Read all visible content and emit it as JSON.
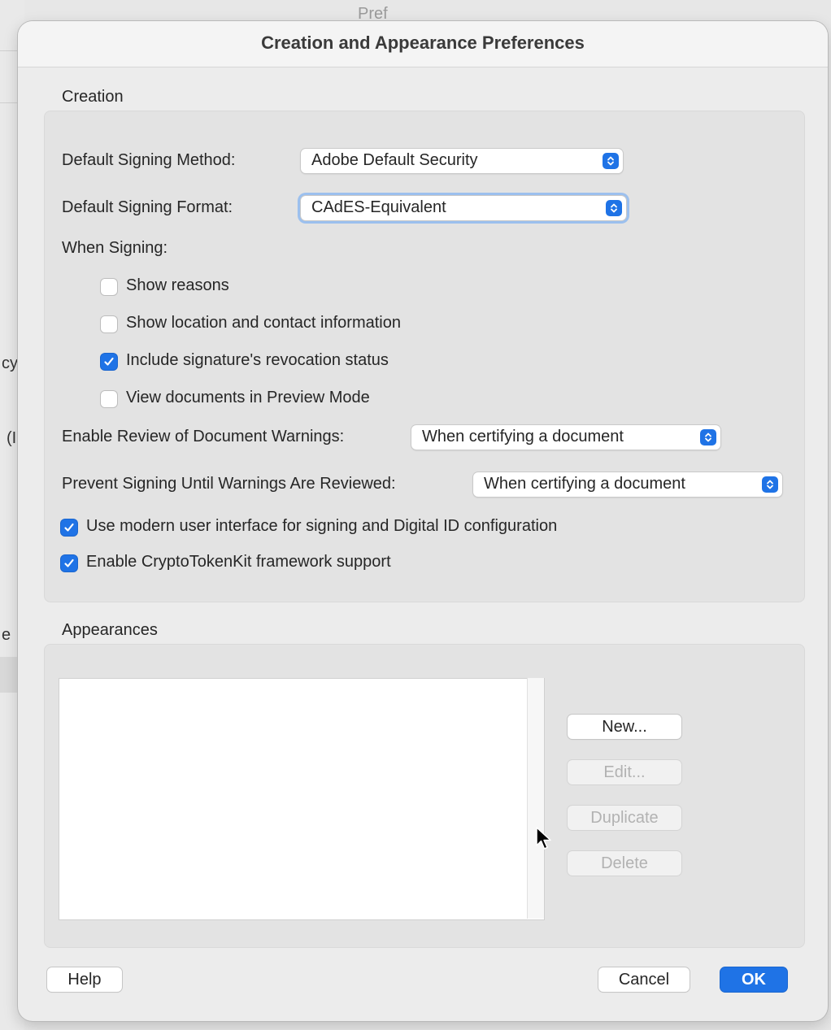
{
  "background": {
    "window_title_fragment": "Pref",
    "fragments": [
      "cy",
      "(I",
      "e"
    ]
  },
  "dialog": {
    "title": "Creation and Appearance Preferences"
  },
  "creation": {
    "section_label": "Creation",
    "signing_method": {
      "label": "Default Signing Method:",
      "value": "Adobe Default Security"
    },
    "signing_format": {
      "label": "Default Signing Format:",
      "value": "CAdES-Equivalent"
    },
    "when_signing_label": "When Signing:",
    "options": [
      {
        "label": "Show reasons",
        "checked": false
      },
      {
        "label": "Show location and contact information",
        "checked": false
      },
      {
        "label": "Include signature's revocation status",
        "checked": true
      },
      {
        "label": "View documents in Preview Mode",
        "checked": false
      }
    ],
    "review_warnings": {
      "label": "Enable Review of Document Warnings:",
      "value": "When certifying a document"
    },
    "prevent_signing": {
      "label": "Prevent Signing Until Warnings Are Reviewed:",
      "value": "When certifying a document"
    },
    "modern_ui": {
      "label": "Use modern user interface for signing and Digital ID configuration",
      "checked": true
    },
    "cryptotokenkit": {
      "label": "Enable CryptoTokenKit framework support",
      "checked": true
    }
  },
  "appearances": {
    "section_label": "Appearances",
    "buttons": {
      "new": "New...",
      "edit": "Edit...",
      "duplicate": "Duplicate",
      "delete": "Delete"
    }
  },
  "footer": {
    "help": "Help",
    "cancel": "Cancel",
    "ok": "OK"
  },
  "colors": {
    "accent": "#1f73e6",
    "dialog_bg": "#ececec",
    "group_bg": "#e3e3e3"
  }
}
